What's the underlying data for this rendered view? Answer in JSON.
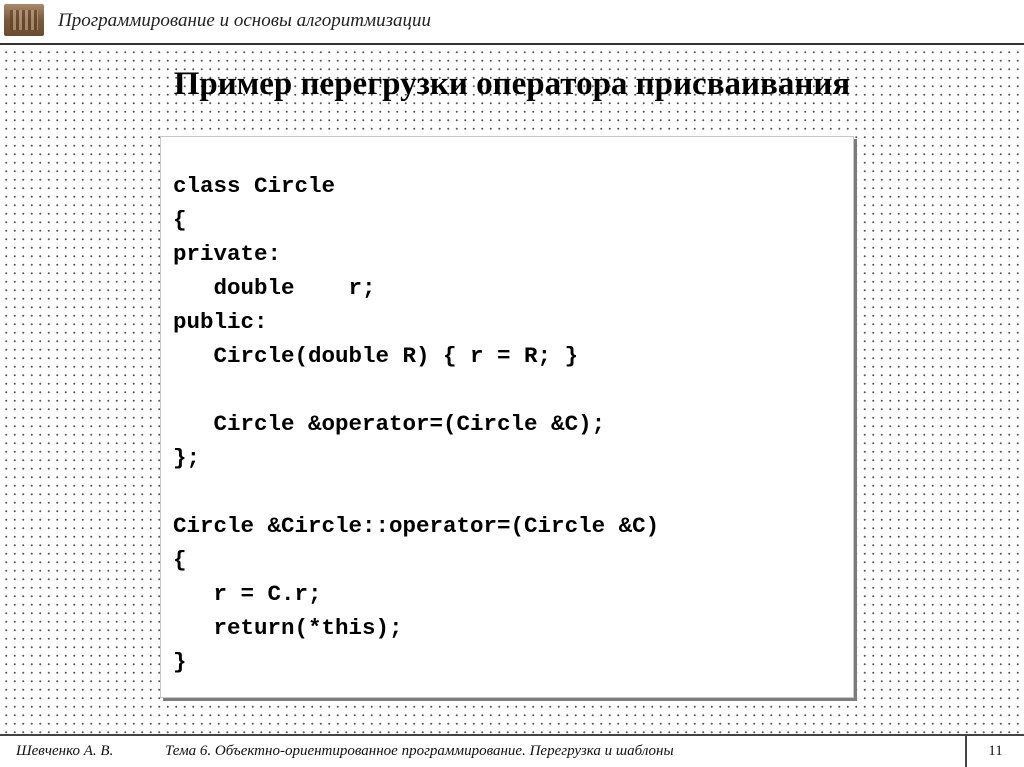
{
  "header": {
    "logo_icon": "book-stack-logo-icon",
    "course_title": "Программирование и основы алгоритмизации"
  },
  "slide": {
    "title": "Пример перегрузки оператора присваивания",
    "code_lines": [
      "class Circle",
      "{",
      "private:",
      "   double    r;",
      "public:",
      "   Circle(double R) { r = R; }",
      "",
      "   Circle &operator=(Circle &C);",
      "};",
      "",
      "Circle &Circle::operator=(Circle &C)",
      "{",
      "   r = C.r;",
      "   return(*this);",
      "}"
    ]
  },
  "footer": {
    "author": "Шевченко А. В.",
    "topic": "Тема 6. Объектно-ориентированное программирование. Перегрузка и шаблоны",
    "page_number": "11"
  }
}
